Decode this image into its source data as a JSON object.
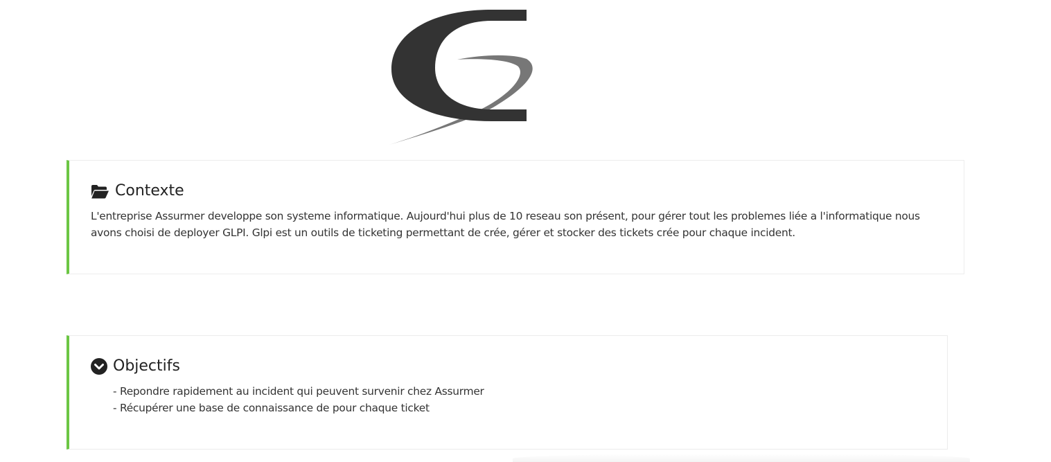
{
  "colors": {
    "accent": "#6cc644",
    "logo_dark": "#333333",
    "logo_light": "#777777",
    "text": "#333333",
    "border": "#ececec"
  },
  "contexte": {
    "icon": "folder-open-icon",
    "title": "Contexte",
    "text": "L'entreprise Assurmer developpe son systeme informatique. Aujourd'hui plus de 10 reseau son présent, pour gérer tout les problemes liée a l'informatique nous avons choisi de deployer GLPI. Glpi est un outils de ticketing permettant de crée, gérer et stocker des tickets crée pour chaque incident."
  },
  "objectifs": {
    "icon": "chevron-circle-down-icon",
    "title": "Objectifs",
    "items": [
      "- Repondre rapidement au incident qui peuvent survenir chez Assurmer",
      "- Récupérer une base de connaissance de pour chaque ticket"
    ]
  }
}
